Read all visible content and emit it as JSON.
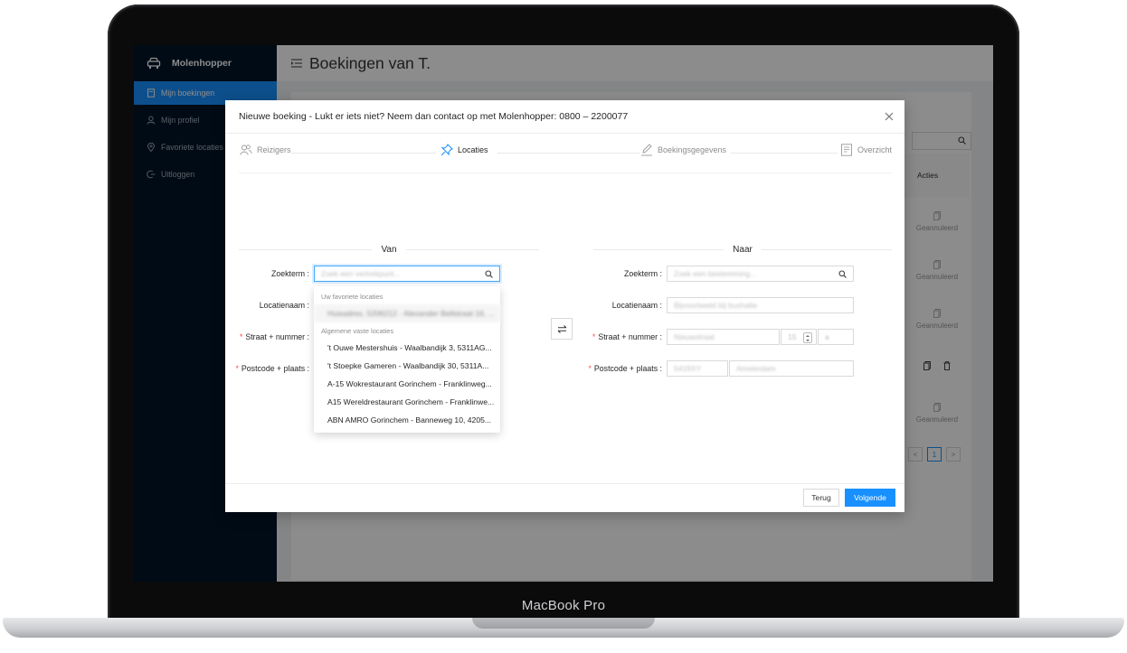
{
  "device": {
    "label": "MacBook Pro"
  },
  "app": {
    "brand": "Molenhopper",
    "nav": [
      {
        "label": "Mijn boekingen",
        "icon": "document-icon",
        "active": true
      },
      {
        "label": "Mijn profiel",
        "icon": "user-icon",
        "active": false
      },
      {
        "label": "Favoriete locaties",
        "icon": "location-icon",
        "active": false
      },
      {
        "label": "Uitloggen",
        "icon": "logout-icon",
        "active": false
      }
    ],
    "page_title": "Boekingen van T.",
    "table": {
      "actions_header": "Acties",
      "rows": [
        "Geannuleerd",
        "Geannuleerd",
        "Geannuleerd",
        "",
        "Geannuleerd"
      ]
    },
    "pagination": {
      "prev": "<",
      "current": "1",
      "next": ">"
    }
  },
  "modal": {
    "title": "Nieuwe boeking - Lukt er iets niet? Neem dan contact op met Molenhopper: 0800 – 2200077",
    "steps": [
      {
        "label": "Reizigers",
        "icon": "users-icon",
        "active": false
      },
      {
        "label": "Locaties",
        "icon": "pin-icon",
        "active": true
      },
      {
        "label": "Boekingsgegevens",
        "icon": "edit-icon",
        "active": false
      },
      {
        "label": "Overzicht",
        "icon": "checklist-icon",
        "active": false
      }
    ],
    "from": {
      "heading": "Van",
      "search_label": "Zoekterm",
      "search_placeholder": "Zoek een vertrekpunt...",
      "location_name_label": "Locatienaam",
      "street_label": "Straat + nummer",
      "postcode_label": "Postcode + plaats"
    },
    "to": {
      "heading": "Naar",
      "search_label": "Zoekterm",
      "search_placeholder": "Zoek een bestemming...",
      "location_name_label": "Locatienaam",
      "location_name_placeholder": "Bijvoorbeeld bij bushalte",
      "street_label": "Straat + nummer",
      "street_placeholder": "Nieuwstraat",
      "number_placeholder": "15",
      "addition_placeholder": "a",
      "postcode_label": "Postcode + plaats",
      "postcode_placeholder": "5419XY",
      "city_placeholder": "Amsterdam"
    },
    "dropdown": {
      "favorites_header": "Uw favoriete locaties",
      "favorites": [
        "Huisadres, 5206212 - Alexander Bellstraat 16, ..."
      ],
      "general_header": "Algemene vaste locaties",
      "general": [
        "'t Ouwe Mestershuis - Waalbandijk 3, 5311AG...",
        "'t Stoepke Gameren - Waalbandijk 30, 5311A...",
        "A-15 Wokrestaurant Gorinchem - Franklinweg...",
        "A15 Wereldrestaurant Gorinchem - Franklinwe...",
        "ABN AMRO Gorinchem - Banneweg 10, 4205..."
      ]
    },
    "buttons": {
      "back": "Terug",
      "next": "Volgende"
    }
  }
}
